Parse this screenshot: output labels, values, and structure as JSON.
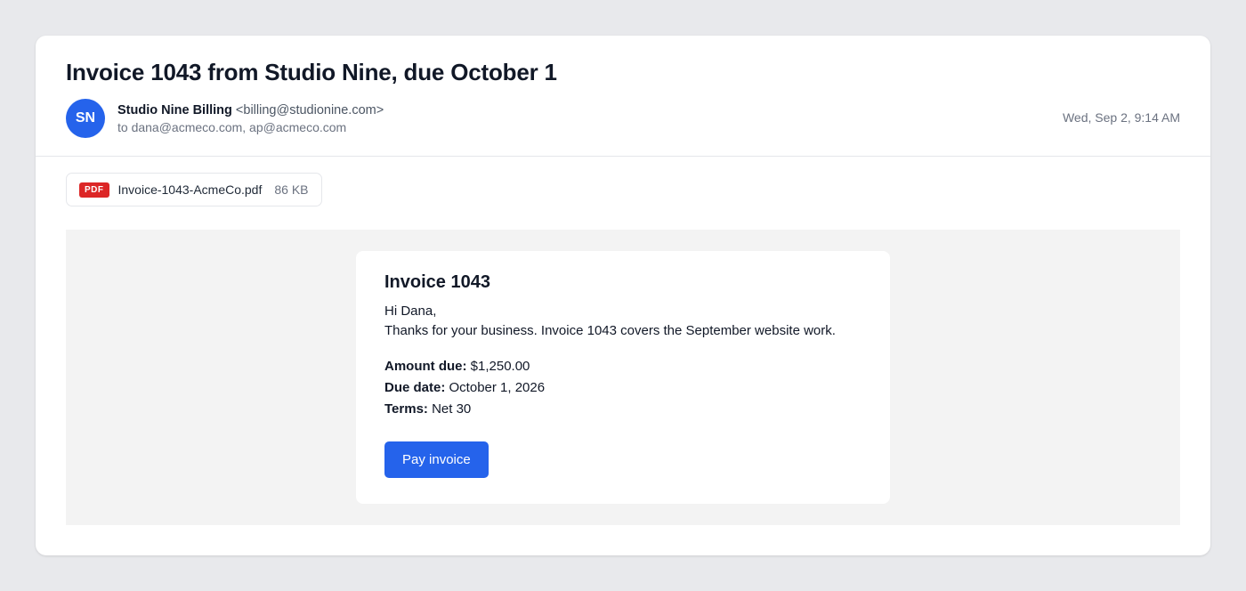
{
  "email": {
    "subject": "Invoice 1043 from Studio Nine, due October 1",
    "sender": {
      "avatar_initials": "SN",
      "name": "Studio Nine Billing",
      "email": "<billing@studionine.com>"
    },
    "recipients": "to dana@acmeco.com, ap@acmeco.com",
    "timestamp": "Wed, Sep 2, 9:14 AM",
    "attachment": {
      "badge": "PDF",
      "filename": "Invoice-1043-AcmeCo.pdf",
      "size": "86 KB"
    }
  },
  "invoice": {
    "title": "Invoice 1043",
    "greeting": "Hi Dana,",
    "message": "Thanks for your business. Invoice 1043 covers the September website work.",
    "details": [
      {
        "label": "Amount due:",
        "value": "$1,250.00"
      },
      {
        "label": "Due date:",
        "value": "October 1, 2026"
      },
      {
        "label": "Terms:",
        "value": "Net 30"
      }
    ],
    "pay_button_label": "Pay invoice"
  },
  "colors": {
    "accent": "#2563eb",
    "pdf_badge": "#dc2626",
    "page_background": "#e8e9ec",
    "email_body_background": "#f3f3f3"
  },
  "icons": {
    "attachment": "pdf-icon"
  }
}
